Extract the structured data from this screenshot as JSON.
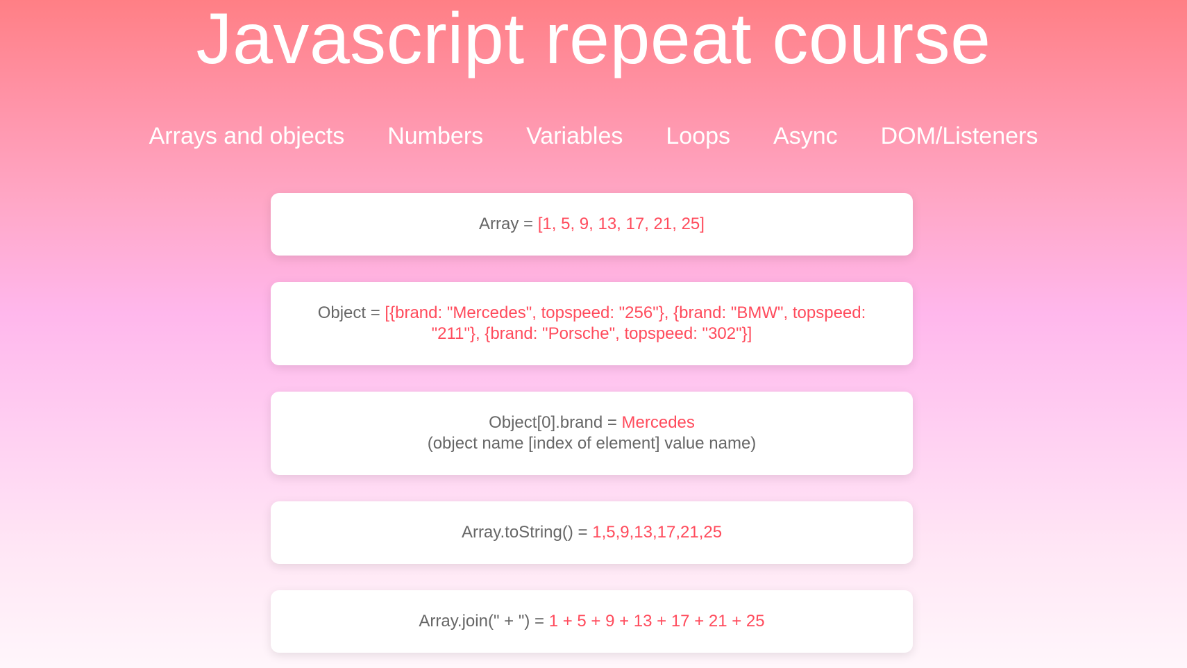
{
  "page": {
    "title": "Javascript repeat course"
  },
  "nav": {
    "items": [
      {
        "label": "Arrays and objects"
      },
      {
        "label": "Numbers"
      },
      {
        "label": "Variables"
      },
      {
        "label": "Loops"
      },
      {
        "label": "Async"
      },
      {
        "label": "DOM/Listeners"
      }
    ]
  },
  "cards": [
    {
      "label": "Array = ",
      "value": "[1, 5, 9, 13, 17, 21, 25]"
    },
    {
      "label": "Object = ",
      "value": "[{brand: \"Mercedes\", topspeed: \"256\"}, {brand: \"BMW\", topspeed: \"211\"}, {brand: \"Porsche\", topspeed: \"302\"}]"
    },
    {
      "label": "Object[0].brand = ",
      "value": "Mercedes",
      "subtext": "(object name [index of element] value name)"
    },
    {
      "label": "Array.toString() = ",
      "value": "1,5,9,13,17,21,25"
    },
    {
      "label": "Array.join(\" + \") = ",
      "value": "1 + 5 + 9 + 13 + 17 + 21 + 25"
    }
  ],
  "colors": {
    "accent_value": "#ff4b5c",
    "text_gray": "#666666",
    "title_white": "#ffffff"
  }
}
